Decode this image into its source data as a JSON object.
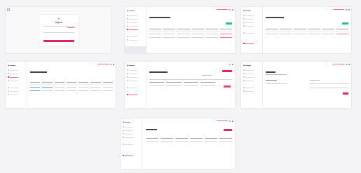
{
  "colors": {
    "accent": "#e0245e",
    "success": "#27c07d",
    "link": "#6aa3d8"
  },
  "login": {
    "title": "Sign In",
    "submit_icon": "arrow-right-icon"
  },
  "screens": [
    {
      "id": "login"
    },
    {
      "id": "list-1"
    },
    {
      "id": "list-2"
    },
    {
      "id": "table-wide"
    },
    {
      "id": "detail"
    },
    {
      "id": "settings"
    },
    {
      "id": "list-3"
    }
  ]
}
